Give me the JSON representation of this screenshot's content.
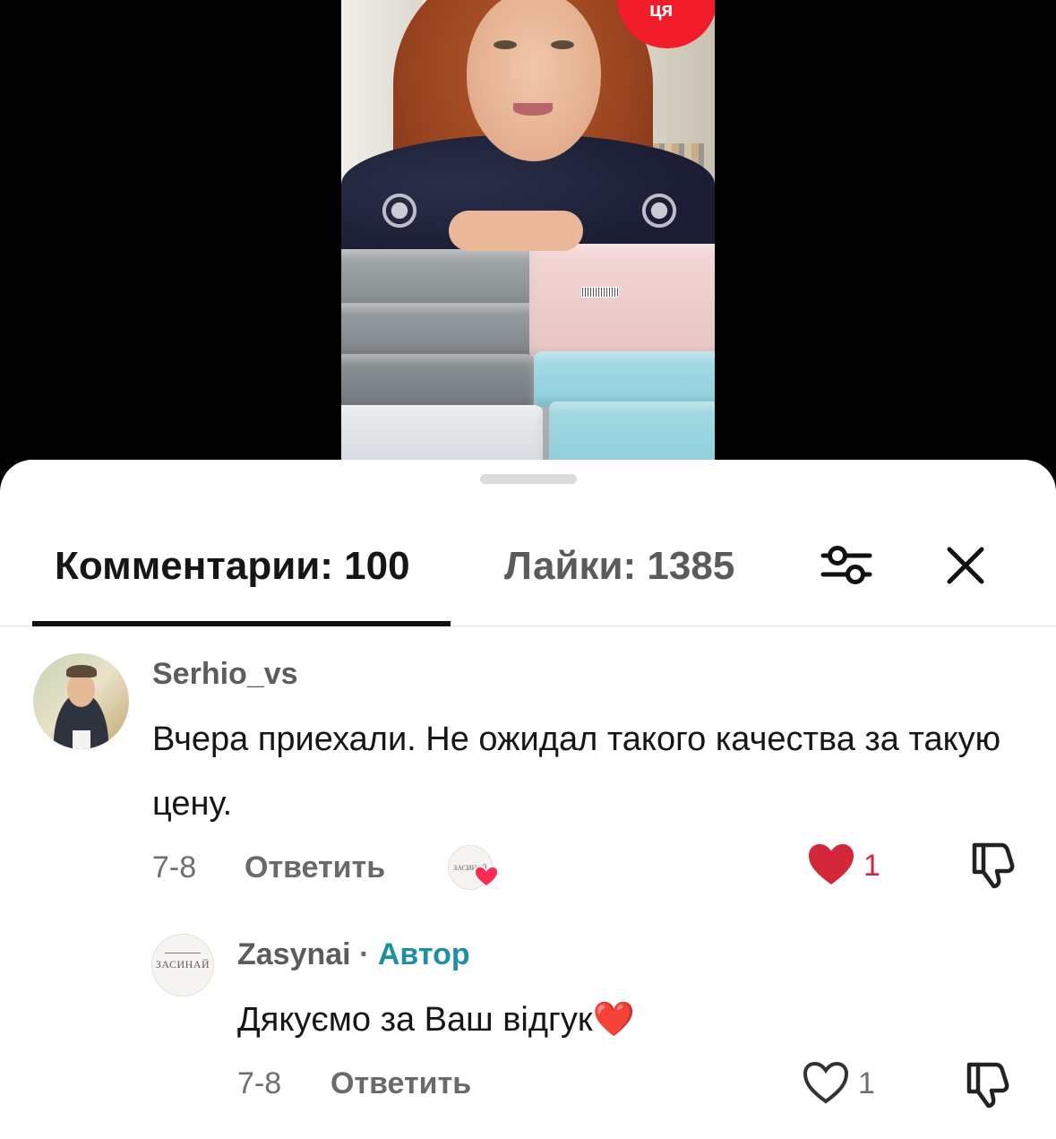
{
  "video": {
    "badge_text": "ця"
  },
  "tabs": {
    "comments_label": "Комментарии: 100",
    "likes_label": "Лайки: 1385"
  },
  "colors": {
    "active_like": "#d2283a",
    "author_tag": "#1f8fa6",
    "badge_red": "#f21d2a"
  },
  "icons": {
    "filter": "filter-sliders-icon",
    "close": "close-icon",
    "like": "heart-icon",
    "dislike": "thumbs-down-icon"
  },
  "comments": [
    {
      "username": "Serhio_vs",
      "text": "Вчера приехали. Не ожидал такого качества за такую цену.",
      "date": "7-8",
      "reply_label": "Ответить",
      "like_count": "1",
      "liked": true,
      "liked_by_creator": true,
      "replies": [
        {
          "username": "Zasynai",
          "separator": "·",
          "author_label": "Автор",
          "text": "Дякуємо за Ваш відгук❤️",
          "date": "7-8",
          "reply_label": "Ответить",
          "like_count": "1",
          "liked": false,
          "avatar_logo_text": "ЗАСИНАЙ"
        }
      ]
    }
  ]
}
